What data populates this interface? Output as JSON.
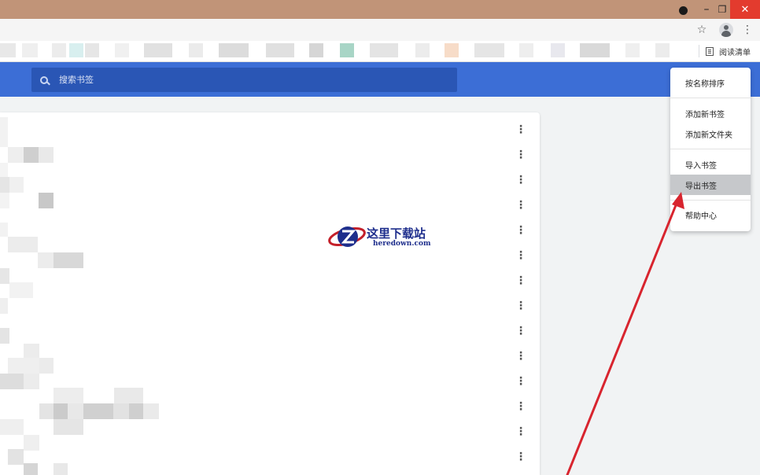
{
  "search": {
    "placeholder": "搜索书签"
  },
  "reading_list": {
    "label": "阅读清单"
  },
  "window_controls": {
    "minimize": "–",
    "maximize": "❐",
    "close": "✕"
  },
  "menu": {
    "sort_by_name": "按名称排序",
    "add_bookmark": "添加新书签",
    "add_folder": "添加新文件夹",
    "import_bookmarks": "导入书签",
    "export_bookmarks": "导出书签",
    "help_center": "帮助中心"
  },
  "watermark": {
    "chinese": "这里下载站",
    "domain": "heredown.com"
  },
  "colors": {
    "title_bar": "#c19478",
    "header_blue": "#3c6ed6",
    "search_bg": "#2a56b5",
    "highlight": "#c6c8cb",
    "arrow_red": "#d8242e",
    "close_red": "#e33b2e"
  }
}
